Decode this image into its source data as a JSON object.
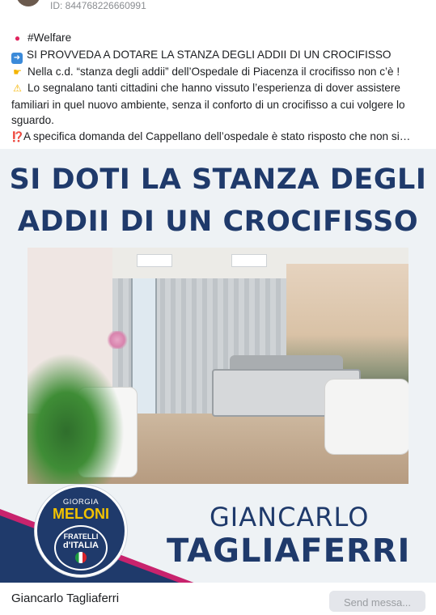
{
  "header": {
    "post_id": "ID: 844768226660991"
  },
  "post": {
    "tag_line": "#Welfare",
    "line1": "SI PROVVEDA A DOTARE LA STANZA DEGLI ADDII DI UN CROCIFISSO",
    "line2": "Nella c.d. “stanza degli addii” dell’Ospedale di Piacenza il crocifisso non c’è !",
    "line3": "Lo segnalano tanti cittadini che hanno vissuto l’esperienza di dover assistere familiari in quel nuovo ambiente, senza il conforto di un crocifisso a cui volgere lo sguardo.",
    "line4_prefix": "⁉️",
    "line4": "A specifica domanda del Cappellano dell’ospedale è stato risposto che non si…"
  },
  "ad_image": {
    "headline_line1": "SI DOTI LA STANZA DEGLI",
    "headline_line2": "ADDII DI UN CROCIFISSO",
    "logo_top": "GIORGIA",
    "logo_main": "MELONI",
    "logo_sub1": "FRATELLI",
    "logo_sub2": "d'ITALIA",
    "candidate_first": "GIANCARLO",
    "candidate_last": "TAGLIAFERRI",
    "colors": {
      "navy": "#1f3a6b",
      "yellow": "#f3c300",
      "magenta": "#c8236d"
    }
  },
  "footer": {
    "page_name": "Giancarlo Tagliaferri",
    "send_button": "Send messa..."
  }
}
